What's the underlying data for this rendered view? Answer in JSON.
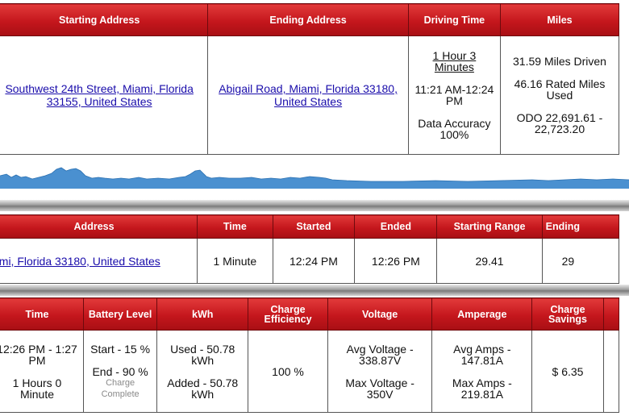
{
  "drive": {
    "headers": {
      "starting_address": "Starting Address",
      "ending_address": "Ending Address",
      "driving_time": "Driving Time",
      "miles": "Miles"
    },
    "starting_address_link": "Southwest 24th Street, Miami, Florida 33155, United States",
    "ending_address_link": "Abigail Road, Miami, Florida 33180, United States",
    "duration_link": "1 Hour 3 Minutes",
    "time_range": "11:21 AM-12:24 PM",
    "data_accuracy": "Data Accuracy 100%",
    "miles_driven": "31.59 Miles Driven",
    "rated_miles_used": "46.16 Rated Miles Used",
    "odometer": "ODO 22,691.61 - 22,723.20"
  },
  "speed_graph": {
    "fill_color": "#4a90d0"
  },
  "stop": {
    "headers": {
      "address": "Address",
      "time": "Time",
      "started": "Started",
      "ended": "Ended",
      "starting_range": "Starting Range",
      "ending": "Ending"
    },
    "address_link": "ami, Florida 33180, United States",
    "time": "1 Minute",
    "started": "12:24 PM",
    "ended": "12:26 PM",
    "starting_range": "29.41",
    "ending_partial": "29"
  },
  "charge": {
    "headers": {
      "time": "Time",
      "battery_level": "Battery Level",
      "kwh": "kWh",
      "charge_efficiency": "Charge Efficiency",
      "voltage": "Voltage",
      "amperage": "Amperage",
      "charge_savings": "Charge Savings"
    },
    "time_range": "12:26 PM - 1:27 PM",
    "duration": "1 Hours 0 Minute",
    "battery_start": "Start - 15 %",
    "battery_end": "End - 90 %",
    "charge_status": "Charge Complete",
    "kwh_used": "Used - 50.78 kWh",
    "kwh_added": "Added - 50.78 kWh",
    "charge_efficiency": "100 %",
    "avg_voltage": "Avg Voltage - 338.87V",
    "max_voltage": "Max Voltage - 350V",
    "avg_amps": "Avg Amps - 147.81A",
    "max_amps": "Max Amps - 219.81A",
    "charge_savings": "$ 6.35"
  }
}
